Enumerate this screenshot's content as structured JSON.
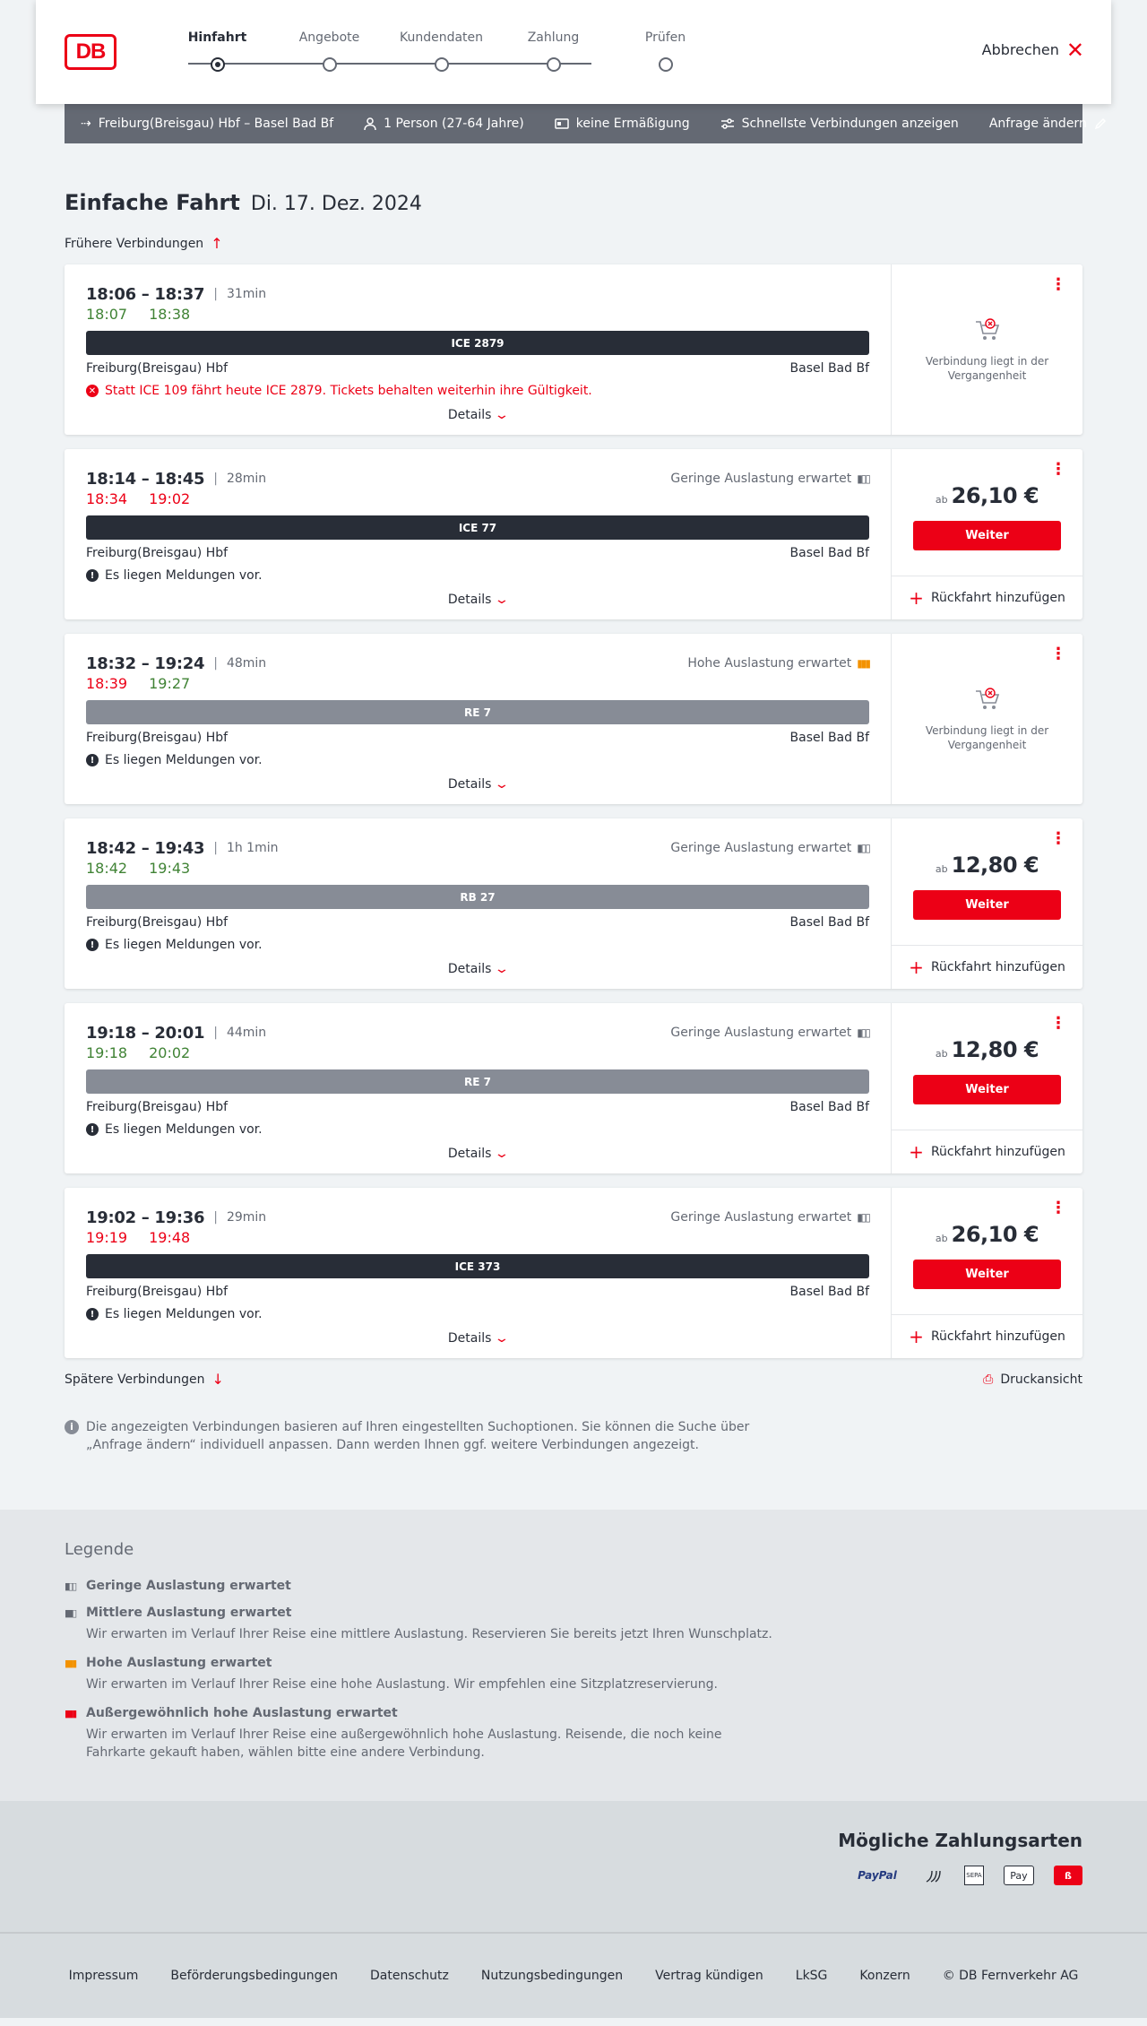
{
  "header": {
    "logo": "DB",
    "steps": [
      {
        "label": "Hinfahrt"
      },
      {
        "label": "Angebote"
      },
      {
        "label": "Kundendaten"
      },
      {
        "label": "Zahlung"
      },
      {
        "label": "Prüfen"
      }
    ],
    "cancel_label": "Abbrechen"
  },
  "summary": {
    "route": "Freiburg(Breisgau) Hbf – Basel Bad Bf",
    "passengers": "1 Person (27-64 Jahre)",
    "discount": "keine Ermäßigung",
    "filter": "Schnellste Verbindungen anzeigen",
    "change": "Anfrage ändern"
  },
  "main": {
    "title": "Einfache Fahrt",
    "date": "Di. 17. Dez. 2024",
    "earlier": "Frühere Verbindungen",
    "later": "Spätere Verbindungen",
    "print": "Druckansicht",
    "info": "Die angezeigten Verbindungen basieren auf Ihren eingestellten Suchoptionen. Sie können die Suche über „Anfrage ändern“ individuell anpassen. Dann werden Ihnen ggf. weitere Verbindungen angezeigt."
  },
  "common": {
    "details": "Details",
    "weiter": "Weiter",
    "return": "Rückfahrt hinzufügen",
    "ab": "ab",
    "past": "Verbindung liegt in der Vergangenheit",
    "from": "Freiburg(Breisgau) Hbf",
    "to": "Basel Bad Bf"
  },
  "connections": [
    {
      "times": "18:06 – 18:37",
      "duration": "31min",
      "load": "",
      "rt_dep": "18:07",
      "rt_arr": "18:38",
      "train": "ICE 2879",
      "message": "Statt ICE 109 fährt heute ICE 2879. Tickets behalten weiterhin ihre Gültigkeit.",
      "price": ""
    },
    {
      "times": "18:14 – 18:45",
      "duration": "28min",
      "load": "Geringe Auslastung erwartet",
      "rt_dep": "18:34",
      "rt_arr": "19:02",
      "train": "ICE 77",
      "message": "Es liegen Meldungen vor.",
      "price": "26,10 €"
    },
    {
      "times": "18:32 – 19:24",
      "duration": "48min",
      "load": "Hohe Auslastung erwartet",
      "rt_dep": "18:39",
      "rt_arr": "19:27",
      "train": "RE 7",
      "message": "Es liegen Meldungen vor.",
      "price": ""
    },
    {
      "times": "18:42 – 19:43",
      "duration": "1h 1min",
      "load": "Geringe Auslastung erwartet",
      "rt_dep": "18:42",
      "rt_arr": "19:43",
      "train": "RB 27",
      "message": "Es liegen Meldungen vor.",
      "price": "12,80 €"
    },
    {
      "times": "19:18 – 20:01",
      "duration": "44min",
      "load": "Geringe Auslastung erwartet",
      "rt_dep": "19:18",
      "rt_arr": "20:02",
      "train": "RE 7",
      "message": "Es liegen Meldungen vor.",
      "price": "12,80 €"
    },
    {
      "times": "19:02 – 19:36",
      "duration": "29min",
      "load": "Geringe Auslastung erwartet",
      "rt_dep": "19:19",
      "rt_arr": "19:48",
      "train": "ICE 373",
      "message": "Es liegen Meldungen vor.",
      "price": "26,10 €"
    }
  ],
  "legend": {
    "title": "Legende",
    "items": [
      {
        "title": "Geringe Auslastung erwartet",
        "desc": ""
      },
      {
        "title": "Mittlere Auslastung erwartet",
        "desc": "Wir erwarten im Verlauf Ihrer Reise eine mittlere Auslastung. Reservieren Sie bereits jetzt Ihren Wunschplatz."
      },
      {
        "title": "Hohe Auslastung erwartet",
        "desc": "Wir erwarten im Verlauf Ihrer Reise eine hohe Auslastung. Wir empfehlen eine Sitzplatzreservierung."
      },
      {
        "title": "Außergewöhnlich hohe Auslastung erwartet",
        "desc": "Wir erwarten im Verlauf Ihrer Reise eine außergewöhnlich hohe Auslastung. Reisende, die noch keine Fahrkarte gekauft haben, wählen bitte eine andere Verbindung."
      }
    ]
  },
  "payments": {
    "title": "Mögliche Zahlungsarten",
    "paypal": "PayPal",
    "sepa": "SEPA",
    "apple": "Pay"
  },
  "footer": {
    "links": [
      "Impressum",
      "Beförderungsbedingungen",
      "Datenschutz",
      "Nutzungsbedingungen",
      "Vertrag kündigen",
      "LkSG",
      "Konzern",
      "© DB Fernverkehr AG"
    ]
  },
  "colors": {
    "brand": "#ec0016",
    "ontime": "#408335",
    "dark": "#282d37",
    "grey": "#878c96",
    "high_load": "#f39200"
  }
}
